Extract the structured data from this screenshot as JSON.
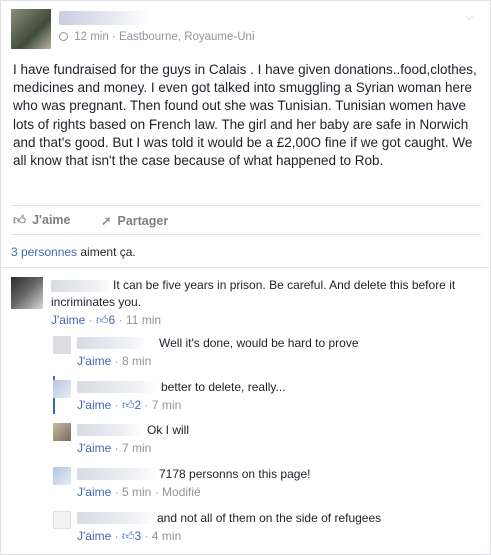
{
  "post": {
    "time": "12 min",
    "location": "Eastbourne, Royaume-Uni",
    "body": "I have fundraised for the guys in Calais . I have given donations..food,clothes, medicines and money. I even got talked into smuggling a Syrian woman here who was pregnant. Then found out she was Tunisian. Tunisian women have lots of rights based on French law. The girl and her baby are safe in Norwich and that's good. But I was told it would be a £2,00O fine if we got caught. We all know that isn't the case because of what happened to Rob."
  },
  "actions": {
    "like": "J'aime",
    "share": "Partager"
  },
  "likes": {
    "people": "3 personnes",
    "suffix": " aiment ça."
  },
  "comments": [
    {
      "text": "It can be five years in prison. Be careful. And delete this before it incriminates you.",
      "like": "J'aime",
      "likes": "6",
      "time": "11 min"
    },
    {
      "text": "Well it's done, would be hard to prove",
      "like": "J'aime",
      "likes": "",
      "time": "8 min"
    },
    {
      "text": "better to delete, really...",
      "like": "J'aime",
      "likes": "2",
      "time": "7 min"
    },
    {
      "text": "Ok I will",
      "like": "J'aime",
      "likes": "",
      "time": "7 min"
    },
    {
      "text": "7178 personns on this page!",
      "like": "J'aime",
      "likes": "",
      "time": "5 min",
      "edited": "Modifié"
    },
    {
      "text": "and not all of them on the side of refugees",
      "like": "J'aime",
      "likes": "3",
      "time": "4 min"
    }
  ],
  "separators": {
    "dot": "·"
  },
  "icons": {
    "menu": "chevron-down-icon",
    "like": "thumbs-up-icon",
    "share": "share-arrow-icon",
    "clock": "clock-icon"
  },
  "colors": {
    "link": "#4267b2",
    "meta": "#90949c",
    "text": "#1d2129"
  }
}
